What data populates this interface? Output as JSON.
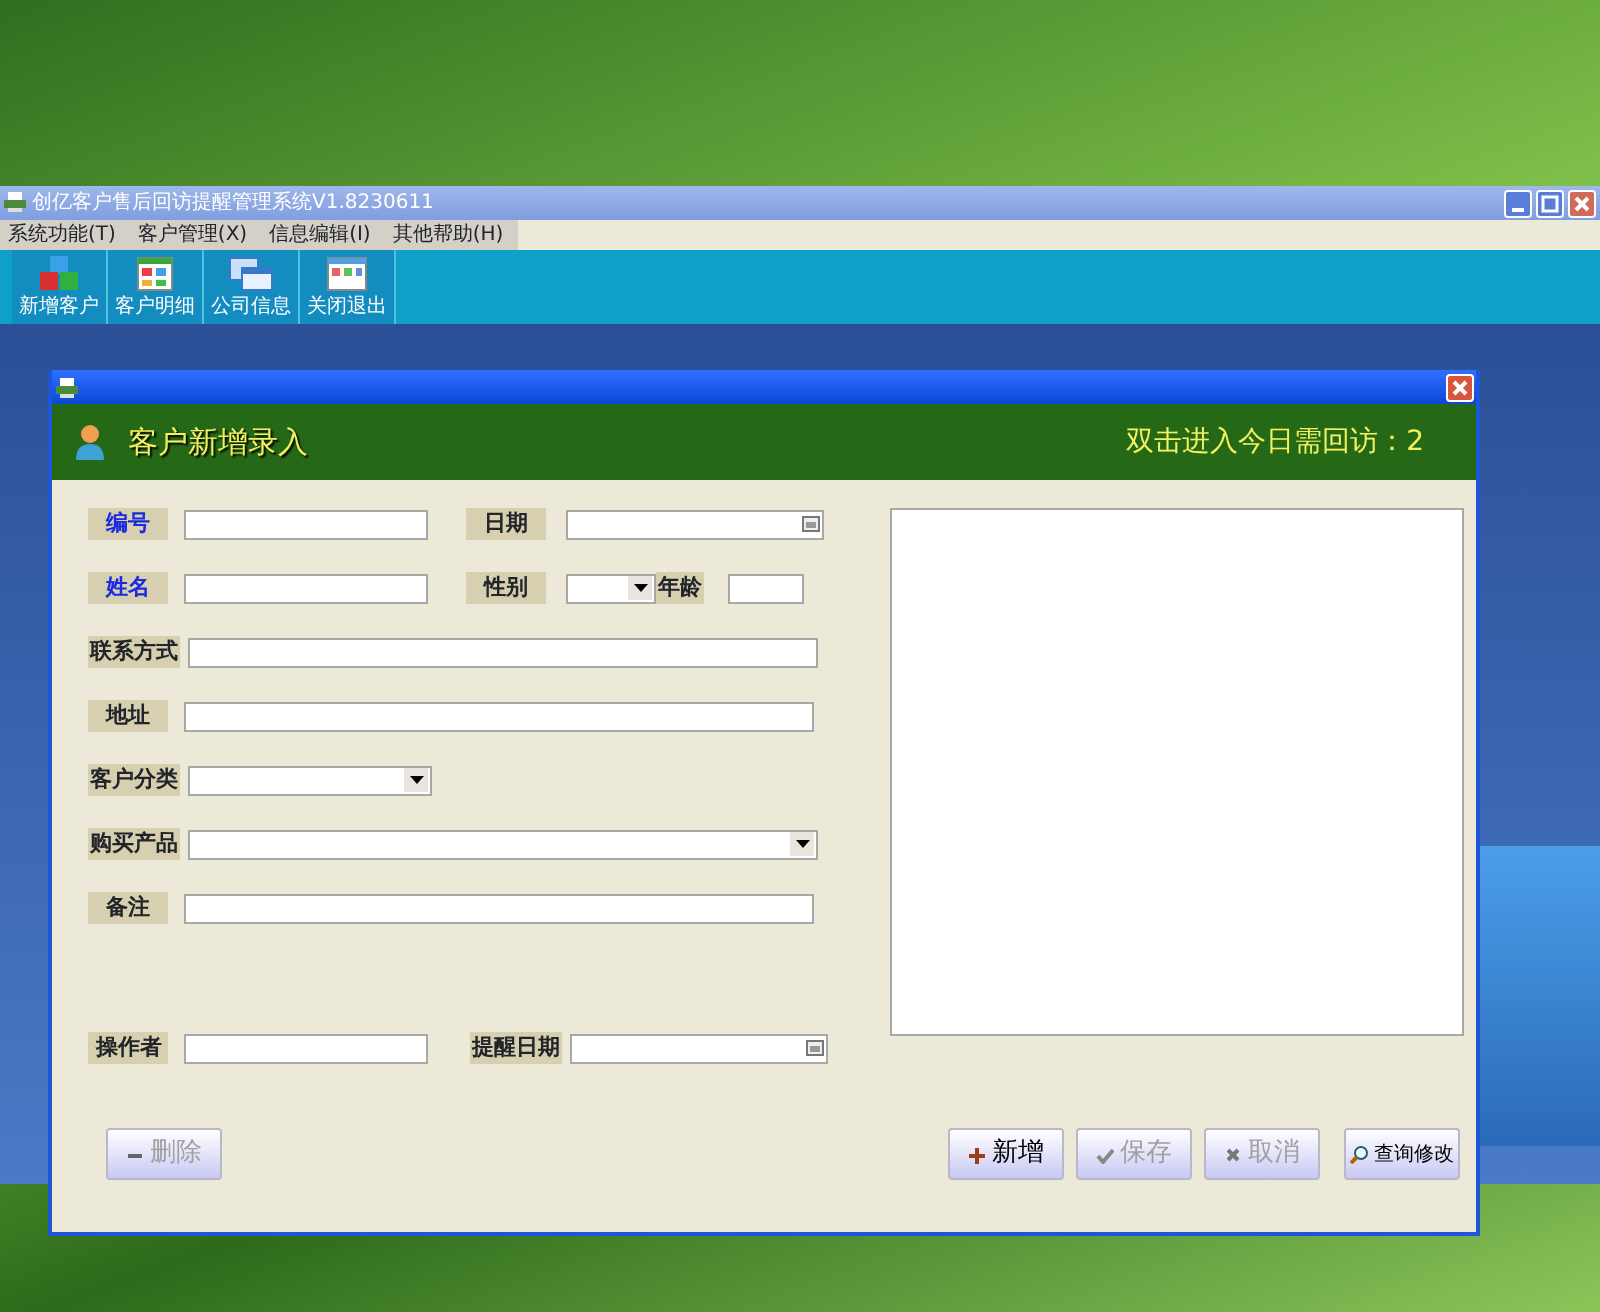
{
  "window": {
    "title": "创亿客户售后回访提醒管理系统V1.8230611",
    "menu": [
      {
        "label": "系统功能(T)"
      },
      {
        "label": "客户管理(X)"
      },
      {
        "label": "信息编辑(I)"
      },
      {
        "label": "其他帮助(H)"
      }
    ],
    "toolbar": [
      {
        "label": "新增客户",
        "kind": "cubes"
      },
      {
        "label": "客户明细",
        "kind": "grid"
      },
      {
        "label": "公司信息",
        "kind": "windows"
      },
      {
        "label": "关闭退出",
        "kind": "panel"
      }
    ]
  },
  "dialog": {
    "header_title": "客户新增录入",
    "reminder": "双击进入今日需回访：2",
    "rows": [
      [
        {
          "label": "编号",
          "kind": "text",
          "required": true
        },
        {
          "label": "日期",
          "kind": "date",
          "required": false
        }
      ],
      [
        {
          "label": "姓名",
          "kind": "text",
          "required": true
        },
        {
          "label": "性别",
          "kind": "short-select",
          "required": false
        },
        {
          "label": "年龄",
          "kind": "short-text",
          "required": false
        }
      ],
      [
        {
          "label": "联系方式",
          "kind": "wide-text",
          "required": false
        }
      ],
      [
        {
          "label": "地址",
          "kind": "wide-text",
          "required": false
        }
      ],
      [
        {
          "label": "客户分类",
          "kind": "select",
          "required": false
        }
      ],
      [
        {
          "label": "购买产品",
          "kind": "wide-select",
          "required": false
        }
      ],
      [
        {
          "label": "备注",
          "kind": "wide-text",
          "required": false
        }
      ],
      [
        {
          "label": "操作者",
          "kind": "text",
          "required": false
        },
        {
          "label": "提醒日期",
          "kind": "date",
          "required": false
        }
      ]
    ],
    "buttons": [
      {
        "label": "删除",
        "kind": "minus",
        "disabled": true
      },
      {
        "label": "新增",
        "kind": "plus",
        "disabled": false
      },
      {
        "label": "保存",
        "kind": "check",
        "disabled": true
      },
      {
        "label": "取消",
        "kind": "cross",
        "disabled": true
      },
      {
        "label": "查询修改",
        "kind": "search",
        "disabled": false
      }
    ]
  }
}
